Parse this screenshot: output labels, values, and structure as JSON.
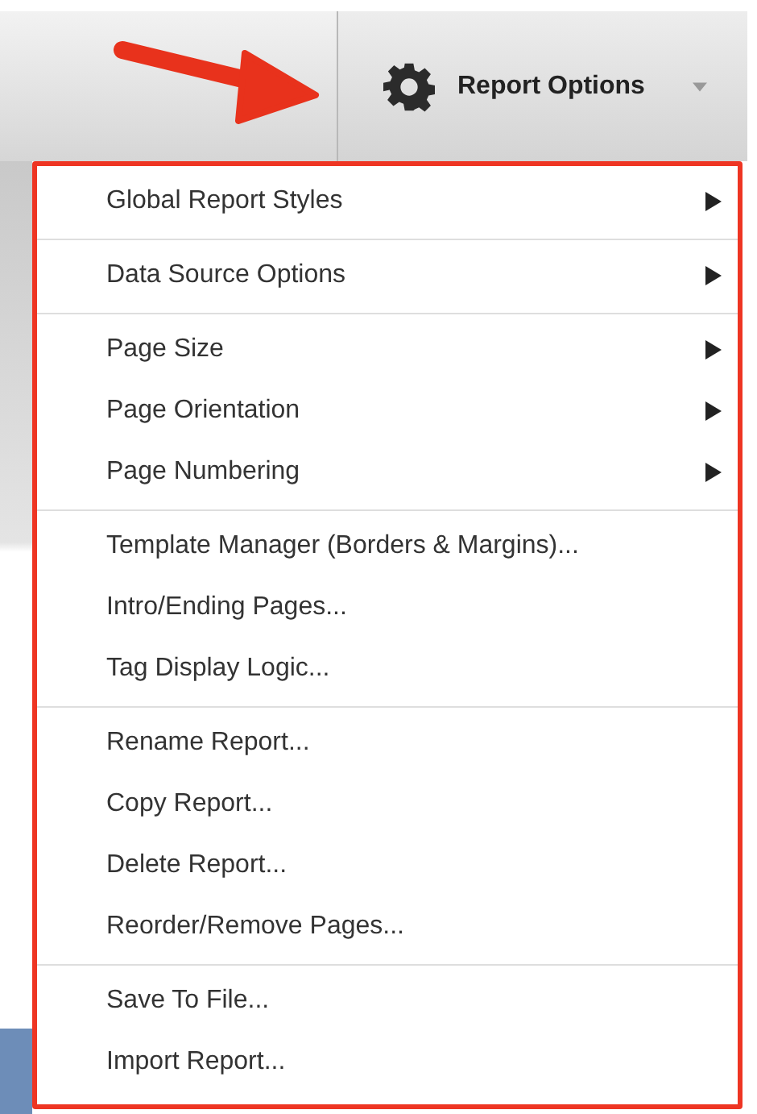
{
  "toolbar": {
    "button": {
      "label": "Report Options"
    }
  },
  "menu": {
    "groups": [
      {
        "items": [
          {
            "label": "Global Report Styles",
            "submenu": true
          }
        ]
      },
      {
        "items": [
          {
            "label": "Data Source Options",
            "submenu": true
          }
        ]
      },
      {
        "items": [
          {
            "label": "Page Size",
            "submenu": true
          },
          {
            "label": "Page Orientation",
            "submenu": true
          },
          {
            "label": "Page Numbering",
            "submenu": true
          }
        ]
      },
      {
        "items": [
          {
            "label": "Template Manager (Borders & Margins)...",
            "submenu": false
          },
          {
            "label": "Intro/Ending Pages...",
            "submenu": false
          },
          {
            "label": "Tag Display Logic...",
            "submenu": false
          }
        ]
      },
      {
        "items": [
          {
            "label": "Rename Report...",
            "submenu": false
          },
          {
            "label": "Copy Report...",
            "submenu": false
          },
          {
            "label": "Delete Report...",
            "submenu": false
          },
          {
            "label": "Reorder/Remove Pages...",
            "submenu": false
          }
        ]
      },
      {
        "items": [
          {
            "label": "Save To File...",
            "submenu": false
          },
          {
            "label": "Import Report...",
            "submenu": false
          }
        ]
      }
    ]
  }
}
